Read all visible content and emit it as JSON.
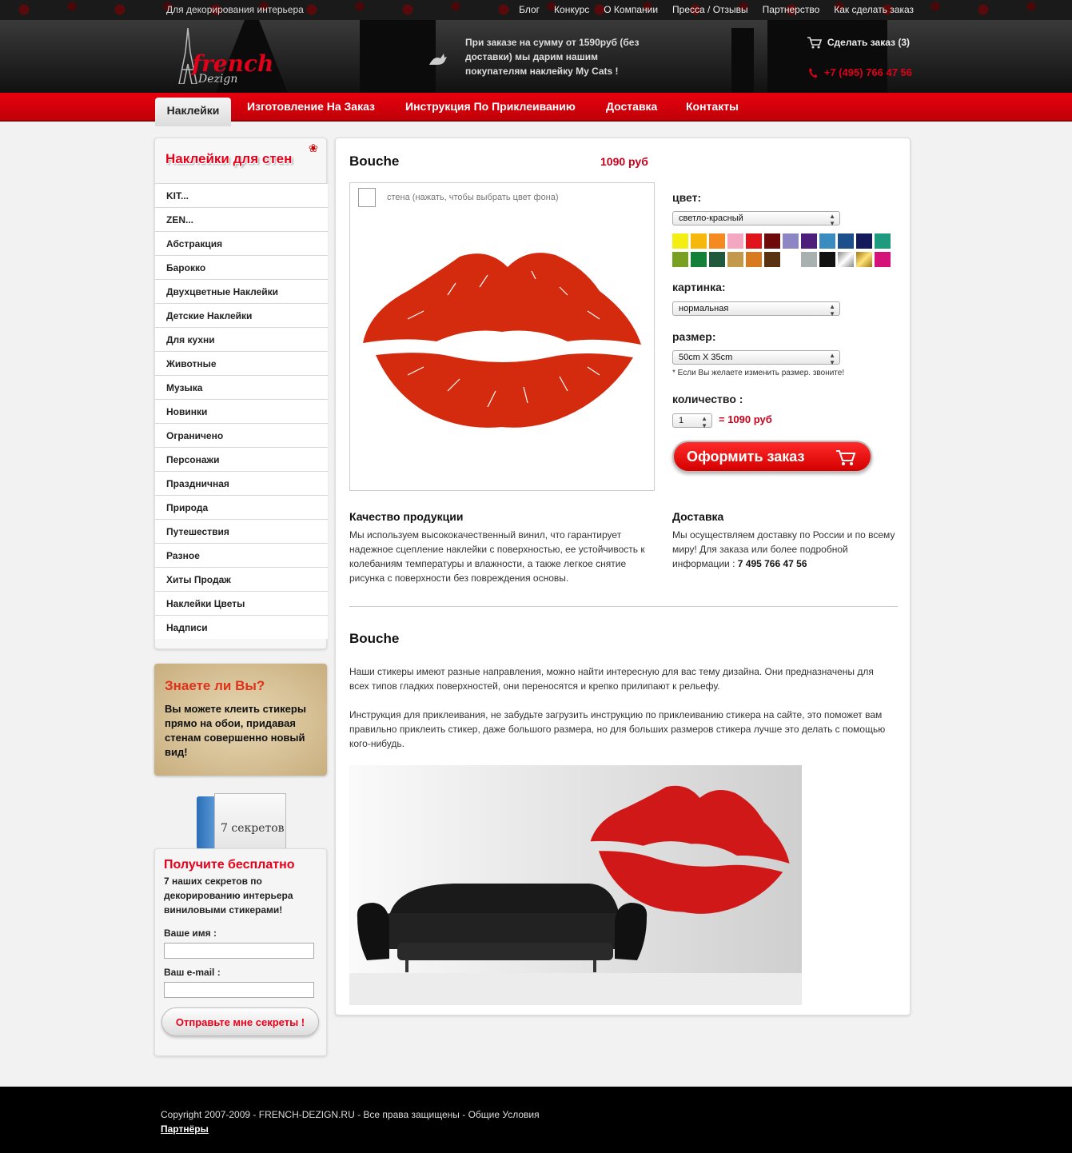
{
  "topbar": {
    "tagline": "Для декорирования интерьера",
    "links": [
      "Блог",
      "Конкурс",
      "О Компании",
      "Пресса / Отзывы",
      "Партнерство",
      "Как сделать заказ"
    ]
  },
  "header": {
    "logo_main": "french",
    "logo_sub": "Dezign",
    "promo": "При заказе на сумму от 1590руб (без доставки) мы дарим нашим покупателям наклейку My Cats !",
    "cart": "Сделать заказ (3)",
    "phone": "+7 (495) 766 47 56"
  },
  "nav": {
    "active": "Наклейки",
    "items": [
      "Изготовление На Заказ",
      "Инструкция По Приклеиванию",
      "Доставка",
      "Контакты"
    ]
  },
  "sidebar": {
    "title": "Наклейки для стен",
    "categories": [
      "KIT...",
      "ZEN...",
      "Абстракция",
      "Барокко",
      "Двухцветные Наклейки",
      "Детские Наклейки",
      "Для кухни",
      "Животные",
      "Музыка",
      "Новинки",
      "Ограничено",
      "Персонажи",
      "Праздничная",
      "Природа",
      "Путешествия",
      "Разное",
      "Хиты Продаж",
      "Наклейки Цветы",
      "Надписи"
    ],
    "know_title": "Знаете ли Вы?",
    "know_text": "Вы можете клеить стикеры прямо на обои, придавая стенам совершенно новый вид!",
    "book_label": "7 секретов",
    "signup_title": "Получите бесплатно",
    "signup_text": "7 наших секретов по декорированию интерьера виниловыми стикерами!",
    "name_label": "Ваше имя :",
    "email_label": "Ваш e-mail :",
    "send_button": "Отправьте мне секреты !"
  },
  "product": {
    "title": "Bouche",
    "price": "1090 руб",
    "wall_hint": "стена (нажать, чтобы выбрать цвет фона)",
    "color_label": "цвет:",
    "color_value": "светло-красный",
    "picture_label": "картинка:",
    "picture_value": "нормальная",
    "size_label": "размер:",
    "size_value": "50cm X 35cm",
    "size_note": "* Если Вы желаете изменить размер. звоните!",
    "qty_label": "количество :",
    "qty_value": "1",
    "qty_total": "= 1090 руб",
    "order_button": "Оформить заказ",
    "swatches": [
      "#f4ee12",
      "#f6b80c",
      "#f58a1f",
      "#f4a7c0",
      "#e0151b",
      "#6e0a0a",
      "#8c86c4",
      "#4d1f7a",
      "#3a8cc0",
      "#1d4f8c",
      "#14195c",
      "#1e9a7e",
      "#7aa022",
      "#13803a",
      "#1f5a3c",
      "#c39a4c",
      "#d87a20",
      "#5a3210",
      "#ffffff",
      "#a9b0b0",
      "#111111",
      "#c0c0c0",
      "#c8a818",
      "#d4127a"
    ]
  },
  "info": {
    "quality_title": "Качество продукции",
    "quality_text": "Мы используем высококачественный винил, что гарантирует надежное сцепление наклейки с поверхностью, ее устойчивость к колебаниям температуры и влажности, а также легкое снятие рисунка с поверхности без повреждения основы.",
    "delivery_title": "Доставка",
    "delivery_text": "Мы осуществляем доставку по России и по всему миру! Для заказа или более подробной информации :",
    "delivery_phone": "7 495 766 47 56"
  },
  "description": {
    "title": "Bouche",
    "p1": "Наши стикеры имеют разные направления, можно найти интересную для вас тему дизайна. Они предназначены для всех типов гладких поверхностей, они переносятся и крепко прилипают к рельефу.",
    "p2": "Инструкция для приклеивания, не забудьте загрузить инструкцию по приклеиванию стикера на сайте, это поможет вам правильно приклеить стикер, даже большого размера, но для больших размеров стикера лучше это делать с помощью кого-нибудь."
  },
  "footer": {
    "copyright": "Copyright 2007-2009 - FRENCH-DEZIGN.RU - Все права защищены - Общие Условия",
    "partners": "Партнёры"
  },
  "colors": {
    "accent": "#e8001a",
    "lips": "#d42a0e"
  }
}
